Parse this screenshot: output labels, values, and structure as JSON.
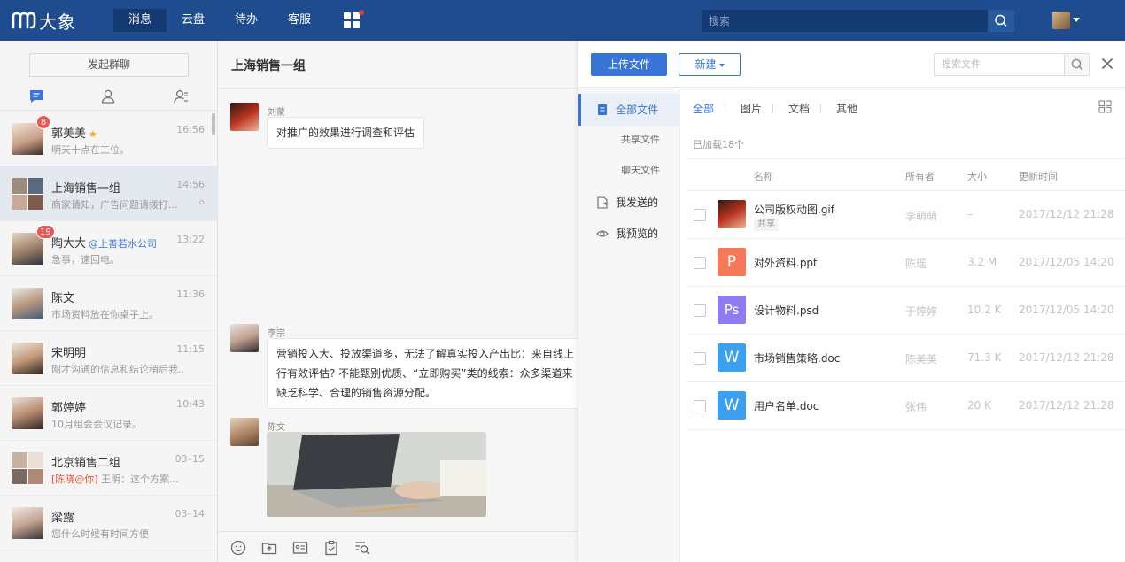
{
  "app": {
    "name": "大象",
    "nav": [
      "消息",
      "云盘",
      "待办",
      "客服"
    ],
    "active_nav": "消息",
    "search_placeholder": "搜索",
    "accent": "#1e4c8f"
  },
  "sidebar": {
    "new_group_label": "发起群聊",
    "tabs": [
      "chat-icon",
      "contacts-icon",
      "org-contacts-icon"
    ],
    "conversations": [
      {
        "name": "郭美美",
        "time": "16:56",
        "preview": "明天十点在工位。",
        "badge": "8",
        "starred": true
      },
      {
        "name": "上海销售一组",
        "time": "14:56",
        "preview": "商家请知，广告问题请拨打...",
        "muted_mark": "⌂"
      },
      {
        "name": "陶大大",
        "company": "@上善若水公司",
        "time": "13:22",
        "preview": "急事，速回电。",
        "badge": "19"
      },
      {
        "name": "陈文",
        "time": "11:36",
        "preview": "市场资料放在你桌子上。"
      },
      {
        "name": "宋明明",
        "time": "11:15",
        "preview": "刚才沟通的信息和结论稍后我..."
      },
      {
        "name": "郭婷婷",
        "time": "10:43",
        "preview": "10月组会会议记录。"
      },
      {
        "name": "北京销售二组",
        "time": "03–15",
        "mention": "[陈晓@你]",
        "preview": "王明：这个方案..."
      },
      {
        "name": "梁露",
        "time": "03–14",
        "preview": "您什么时候有时间方便"
      }
    ]
  },
  "chat": {
    "title": "上海销售一组",
    "messages": [
      {
        "sender": "刘蒙",
        "text": "对推广的效果进行调查和评估"
      },
      {
        "sender": "李宗",
        "lines": [
          "营销投入大、投放渠道多，无法了解真实投入产出比：来自线上",
          "行有效评估? 不能甄别优质、“立即购买”类的线索：众多渠道来",
          "缺乏科学、合理的销售资源分配。"
        ]
      },
      {
        "sender": "陈文",
        "image": "laptop-photo"
      }
    ],
    "tools": [
      "emoji-icon",
      "upload-folder-icon",
      "screenshot-icon",
      "clipboard-check-icon",
      "search-history-icon"
    ]
  },
  "files": {
    "upload_label": "上传文件",
    "new_label": "新建",
    "search_placeholder": "搜索文件",
    "nav": [
      {
        "label": "全部文件",
        "icon": "document-icon",
        "active": true
      },
      {
        "label": "共享文件",
        "sub": true
      },
      {
        "label": "聊天文件",
        "sub": true
      },
      {
        "label": "我发送的",
        "icon": "sent-file-icon"
      },
      {
        "label": "我预览的",
        "icon": "eye-icon"
      }
    ],
    "tabs": [
      "全部",
      "图片",
      "文档",
      "其他"
    ],
    "loaded_text": "已加载18个",
    "columns": {
      "name": "名称",
      "owner": "所有者",
      "size": "大小",
      "updated": "更新时间"
    },
    "rows": [
      {
        "name": "公司版权动图.gif",
        "tag": "共享",
        "owner": "李萌萌",
        "size": "–",
        "updated": "2017/12/12 21:28",
        "type": "gif",
        "color": "#c0392b"
      },
      {
        "name": "对外资料.ppt",
        "owner": "陈瑶",
        "size": "3.2 M",
        "updated": "2017/12/05 14:20",
        "type": "ppt",
        "letter": "P",
        "color": "#f5795b"
      },
      {
        "name": "设计物料.psd",
        "owner": "于婷婷",
        "size": "10.2 K",
        "updated": "2017/12/05 14:20",
        "type": "psd",
        "letter": "Ps",
        "color": "#8e7cf1"
      },
      {
        "name": "市场销售策略.doc",
        "owner": "陈美美",
        "size": "71.3 K",
        "updated": "2017/12/12 21:28",
        "type": "doc",
        "letter": "W",
        "color": "#3aa0f0"
      },
      {
        "name": "用户名单.doc",
        "owner": "张伟",
        "size": "20 K",
        "updated": "2017/12/12 21:28",
        "type": "doc",
        "letter": "W",
        "color": "#3aa0f0"
      }
    ]
  }
}
